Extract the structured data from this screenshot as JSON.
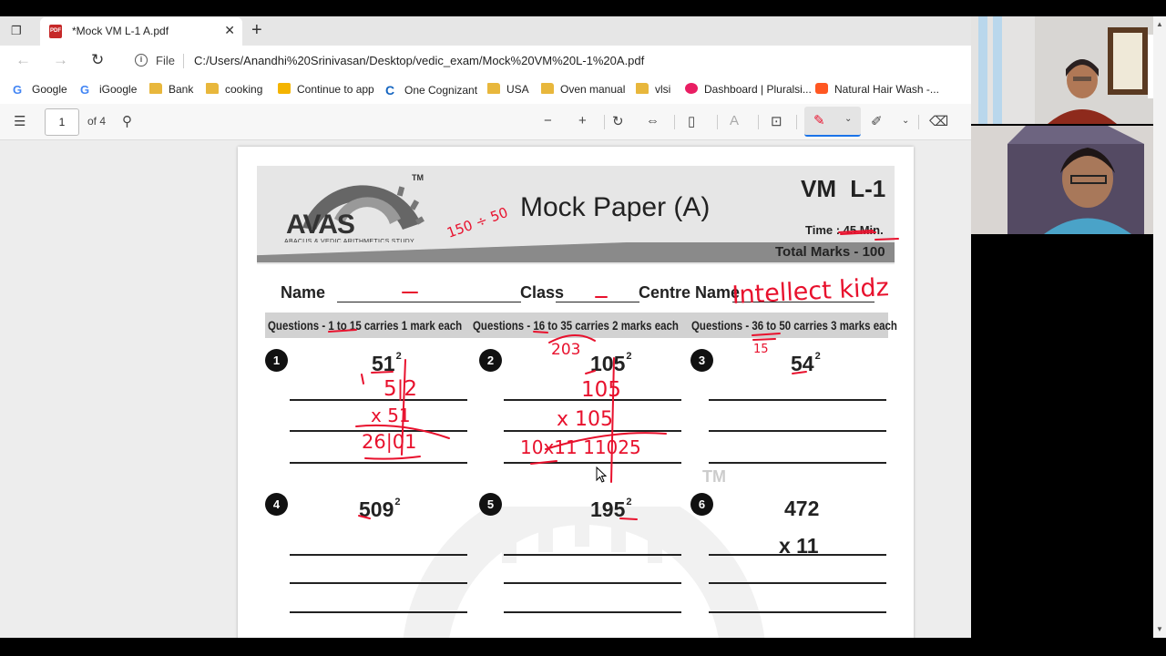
{
  "browser": {
    "tab_title": "*Mock VM L-1 A.pdf",
    "file_label": "File",
    "url": "C:/Users/Anandhi%20Srinivasan/Desktop/vedic_exam/Mock%20VM%20L-1%20A.pdf"
  },
  "bookmarks": [
    {
      "label": "Google",
      "icon": "google-icon"
    },
    {
      "label": "iGoogle",
      "icon": "google-icon"
    },
    {
      "label": "Bank",
      "icon": "folder-icon"
    },
    {
      "label": "cooking",
      "icon": "folder-icon"
    },
    {
      "label": "Continue to app",
      "icon": "app-icon"
    },
    {
      "label": "One Cognizant",
      "icon": "cognizant-icon"
    },
    {
      "label": "USA",
      "icon": "folder-icon"
    },
    {
      "label": "Oven manual",
      "icon": "folder-icon"
    },
    {
      "label": "vlsi",
      "icon": "folder-icon"
    },
    {
      "label": "Dashboard | Pluralsi...",
      "icon": "pluralsight-icon"
    },
    {
      "label": "Natural Hair Wash -...",
      "icon": "blogger-icon"
    }
  ],
  "pdf_toolbar": {
    "page_number": "1",
    "page_total": "of 4"
  },
  "paper": {
    "logo": "AVAS",
    "logo_subtitle": "ABACUS & VEDIC ARITHMETICS STUDY",
    "tm": "TM",
    "title": "Mock Paper (A)",
    "level": "VM  L-1",
    "time": "Time : 45 Min.",
    "total_marks": "Total Marks - 100",
    "name_label": "Name",
    "class_label": "Class",
    "centre_label": "Centre Name",
    "marks_info": [
      "Questions - 1 to 15 carries 1 mark each",
      "Questions - 16 to 35 carries 2 marks each",
      "Questions - 36 to 50 carries 3 marks each"
    ],
    "questions": [
      {
        "num": "1",
        "base": "51",
        "exp": "2"
      },
      {
        "num": "2",
        "base": "105",
        "exp": "2"
      },
      {
        "num": "3",
        "base": "54",
        "exp": "2"
      },
      {
        "num": "4",
        "base": "509",
        "exp": "2"
      },
      {
        "num": "5",
        "base": "195",
        "exp": "2"
      },
      {
        "num": "6",
        "base": "472",
        "exp": "",
        "line2": "x 11"
      }
    ],
    "handwriting": {
      "centre_name": "Intellect kidz",
      "q1_work": [
        "5|2",
        "51",
        "x 51",
        "26|01"
      ],
      "q2_work": [
        "105",
        "x 105",
        "10x11  11025"
      ],
      "top_note": "150 ÷ 50",
      "marks_note_1": "203",
      "marks_note_2": "15"
    }
  },
  "colors": {
    "ink": "#e8112d",
    "header_bg": "#e6e6e6",
    "accent": "#1a73e8"
  }
}
